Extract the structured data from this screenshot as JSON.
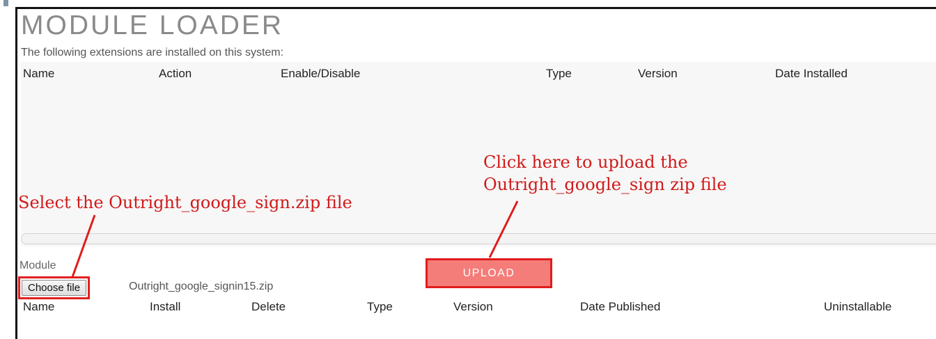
{
  "page": {
    "title": "MODULE LOADER",
    "installed_text": "The following extensions are installed on this system:"
  },
  "installed_table": {
    "headers": [
      "Name",
      "Action",
      "Enable/Disable",
      "Type",
      "Version",
      "Date Installed"
    ]
  },
  "upload": {
    "module_label": "Module",
    "choose_button": "Choose file",
    "selected_file": "Outright_google_signin15.zip",
    "upload_button": "UPLOAD"
  },
  "available_table": {
    "headers": [
      "Name",
      "Install",
      "Delete",
      "Type",
      "Version",
      "Date Published",
      "Uninstallable"
    ]
  },
  "annotations": {
    "select_file": "Select the Outright_google_sign.zip file",
    "upload_line1": "Click here to upload the",
    "upload_line2": "Outright_google_sign zip file",
    "color": "#d01a1a"
  },
  "colors": {
    "upload_button_fill": "#f47c79",
    "highlight_border": "#e01c1c"
  }
}
